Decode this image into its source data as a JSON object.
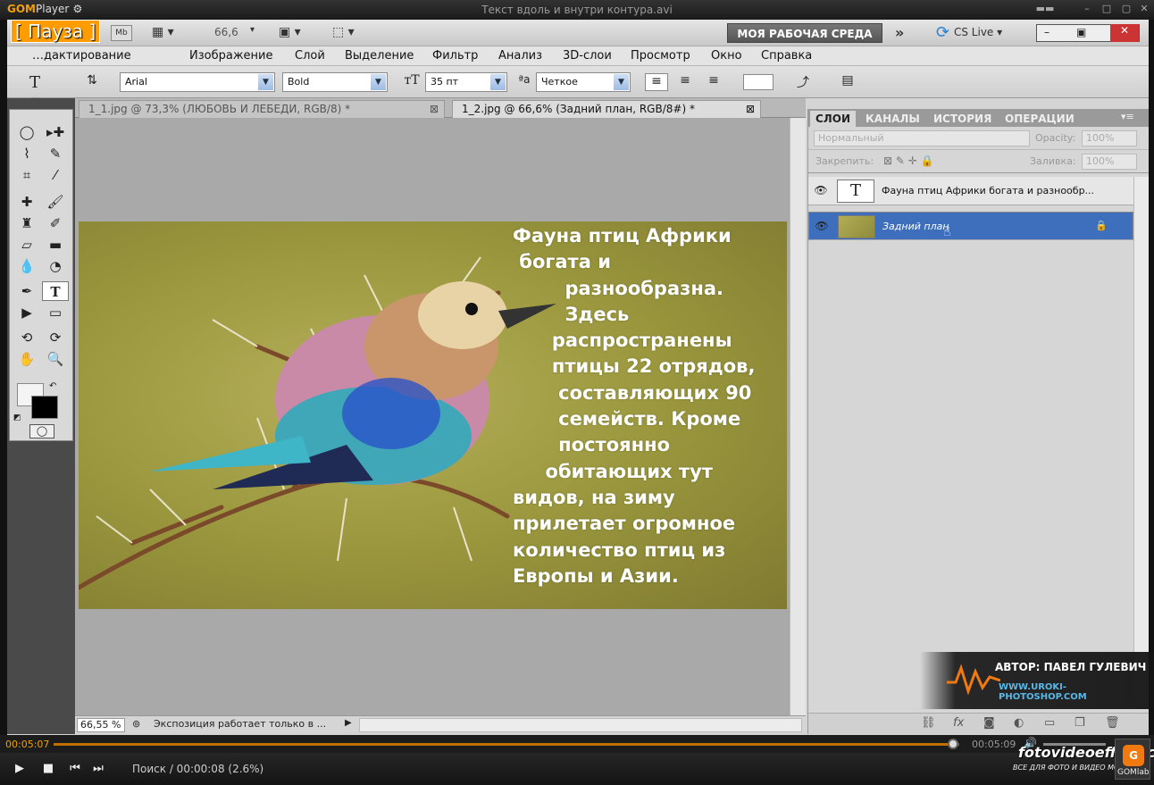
{
  "player": {
    "logo_brand": "GOM",
    "logo_word": "Player",
    "window_title": "Текст вдоль и внутри контура.avi",
    "pause_label": "[ Пауза ]",
    "elapsed": "00:05:07",
    "duration": "00:05:09",
    "seek_message": "Поиск / 00:00:08 (2.6%)",
    "progress": 0.993,
    "brand": "fotovideoeffect.com",
    "brand_sub": "ВСЕ ДЛЯ ФОТО И ВИДЕО МОНТАЖА!",
    "gomlab": "GOMlab"
  },
  "appbar": {
    "ps_logo": "Ps",
    "br": "Br",
    "mb": "Mb",
    "zoom": "66,6",
    "workspace": "МОЯ РАБОЧАЯ СРЕДА",
    "cslive": "CS Live"
  },
  "menu": [
    "…дактирование",
    "Изображение",
    "Слой",
    "Выделение",
    "Фильтр",
    "Анализ",
    "3D-слои",
    "Просмотр",
    "Окно",
    "Справка"
  ],
  "options": {
    "font_family": "Arial",
    "font_style": "Bold",
    "font_size": "35 пт",
    "antialias": "Четкое"
  },
  "tabs": [
    {
      "label": "1_1.jpg @ 73,3% (ЛЮБОВЬ     И     ЛЕБЕДИ, RGB/8) *"
    },
    {
      "label": "1_2.jpg @ 66,6% (Задний план, RGB/8#) *"
    }
  ],
  "article_lines": [
    "Фауна птиц Африки",
    " богата и",
    "        разнообразна.",
    "        Здесь",
    "      распространены",
    "      птицы 22 отрядов,",
    "       составляющих 90",
    "       семейств. Кроме",
    "       постоянно",
    "     обитающих тут",
    "видов, на зиму",
    "прилетает огромное",
    "количество птиц из",
    "Европы и Азии."
  ],
  "status": {
    "zoom": "66,55 %",
    "message": "Экспозиция работает только в ..."
  },
  "panel": {
    "tabs": [
      "СЛОИ",
      "КАНАЛЫ",
      "ИСТОРИЯ",
      "ОПЕРАЦИИ"
    ],
    "blend_mode": "Нормальный",
    "opacity_label": "Opacity:",
    "opacity_value": "100%",
    "lock_label": "Закрепить:",
    "fill_label": "Заливка:",
    "fill_value": "100%",
    "layers": [
      {
        "name": "Фауна птиц Африки богата и разнообр...",
        "thumb": "T",
        "selected": false
      },
      {
        "name": "Задний план",
        "thumb": "",
        "selected": true
      }
    ]
  },
  "watermark": {
    "author": "АВТОР: ПАВЕЛ ГУЛЕВИЧ",
    "site": "WWW.UROKI-PHOTOSHOP.COM"
  }
}
